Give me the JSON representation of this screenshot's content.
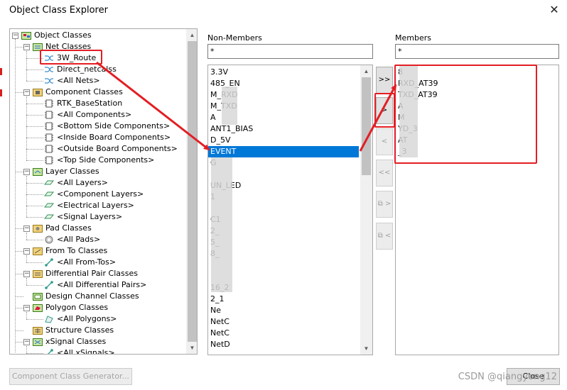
{
  "window": {
    "title": "Object Class Explorer",
    "close_glyph": "✕"
  },
  "tree": {
    "root": {
      "label": "Object Classes",
      "icon": "object-classes-icon"
    },
    "items": [
      {
        "label": "Net Classes",
        "icon": "net-classes-icon",
        "level": 1,
        "expander": "−"
      },
      {
        "label": "3W_Route",
        "icon": "net-class-icon",
        "level": 2,
        "selected": true
      },
      {
        "label": "Direct_netcalss",
        "icon": "net-class-icon",
        "level": 2
      },
      {
        "label": "<All Nets>",
        "icon": "net-class-icon",
        "level": 2
      },
      {
        "label": "Component Classes",
        "icon": "component-classes-icon",
        "level": 1,
        "expander": "−"
      },
      {
        "label": "RTK_BaseStation",
        "icon": "component-class-icon",
        "level": 2
      },
      {
        "label": "<All Components>",
        "icon": "component-class-icon",
        "level": 2
      },
      {
        "label": "<Bottom Side Components>",
        "icon": "component-class-icon",
        "level": 2
      },
      {
        "label": "<Inside Board Components>",
        "icon": "component-class-icon",
        "level": 2
      },
      {
        "label": "<Outside Board Components>",
        "icon": "component-class-icon",
        "level": 2
      },
      {
        "label": "<Top Side Components>",
        "icon": "component-class-icon",
        "level": 2
      },
      {
        "label": "Layer Classes",
        "icon": "layer-classes-icon",
        "level": 1,
        "expander": "−"
      },
      {
        "label": "<All Layers>",
        "icon": "layer-class-icon",
        "level": 2
      },
      {
        "label": "<Component Layers>",
        "icon": "layer-class-icon",
        "level": 2
      },
      {
        "label": "<Electrical Layers>",
        "icon": "layer-class-icon",
        "level": 2
      },
      {
        "label": "<Signal Layers>",
        "icon": "layer-class-icon",
        "level": 2
      },
      {
        "label": "Pad Classes",
        "icon": "pad-classes-icon",
        "level": 1,
        "expander": "−"
      },
      {
        "label": "<All Pads>",
        "icon": "pad-class-icon",
        "level": 2
      },
      {
        "label": "From To Classes",
        "icon": "from-to-classes-icon",
        "level": 1,
        "expander": "−"
      },
      {
        "label": "<All From-Tos>",
        "icon": "from-to-class-icon",
        "level": 2
      },
      {
        "label": "Differential Pair Classes",
        "icon": "diff-pair-classes-icon",
        "level": 1,
        "expander": "−"
      },
      {
        "label": "<All Differential Pairs>",
        "icon": "diff-pair-class-icon",
        "level": 2
      },
      {
        "label": "Design Channel Classes",
        "icon": "design-channel-classes-icon",
        "level": 1
      },
      {
        "label": "Polygon Classes",
        "icon": "polygon-classes-icon",
        "level": 1,
        "expander": "−"
      },
      {
        "label": "<All Polygons>",
        "icon": "polygon-class-icon",
        "level": 2
      },
      {
        "label": "Structure Classes",
        "icon": "structure-classes-icon",
        "level": 1
      },
      {
        "label": "xSignal Classes",
        "icon": "xsignal-classes-icon",
        "level": 1,
        "expander": "−"
      },
      {
        "label": "<All xSignals>",
        "icon": "xsignal-class-icon",
        "level": 2
      }
    ]
  },
  "non_members": {
    "header": "Non-Members",
    "filter_value": "*",
    "items": [
      "3.3V",
      "485_EN",
      "M_RXD",
      "M_TXD",
      "A",
      "ANT1_BIAS",
      "D_5V",
      "EVENT",
      "G",
      "",
      "UN_LED",
      "1",
      "",
      "C1",
      "2_",
      "5_",
      "8_",
      "",
      "",
      "16_2",
      "2_1",
      "Ne",
      "NetC",
      "NetC",
      "NetD"
    ],
    "selected": "EVENT"
  },
  "members": {
    "header": "Members",
    "filter_value": "*",
    "items": [
      "8",
      "RXD_AT39",
      "TXD_AT39",
      "A",
      "M",
      "YD_3",
      "AT",
      "_3"
    ]
  },
  "move_buttons": {
    "add_all": ">>",
    "add": ">",
    "remove": "<",
    "remove_all": "<<",
    "copy_right": "⧉ >",
    "copy_left": "⧉ <"
  },
  "footer": {
    "generator_button": "Component Class Generator...",
    "close_button": "Close",
    "watermark": "CSDN @qiangyong12"
  },
  "colors": {
    "selection": "#0078d7",
    "annotation": "#e31e24"
  }
}
